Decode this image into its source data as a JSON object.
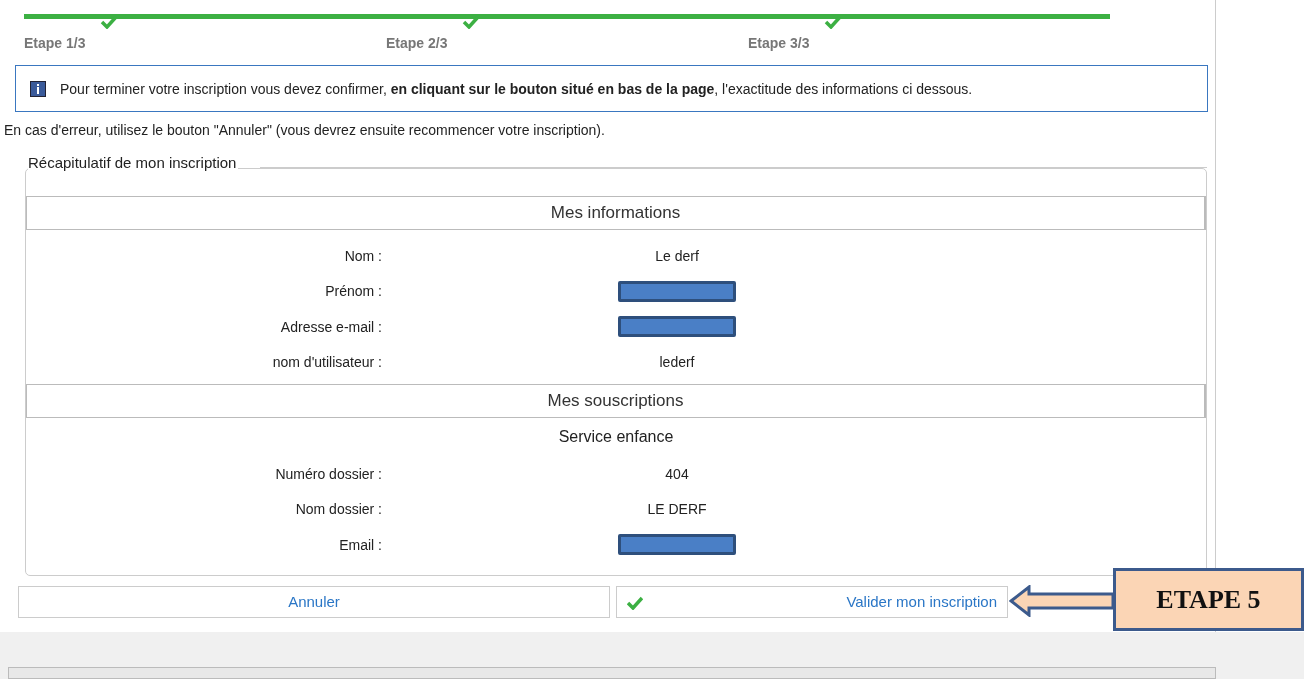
{
  "steps": [
    {
      "label": "Etape 1/3",
      "done": true
    },
    {
      "label": "Etape 2/3",
      "done": true
    },
    {
      "label": "Etape 3/3",
      "done": true
    }
  ],
  "info": "Pour terminer votre inscription vous devez confirmer, **en cliquant sur le bouton situé en bas de la page**, l'exactitude des informations ci dessous.",
  "error_note": "En cas d'erreur, utilisez le bouton \"Annuler\" (vous devrez ensuite recommencer votre inscription).",
  "summary": {
    "title": "Récapitulatif de mon inscription",
    "sections": [
      {
        "title": "Mes informations",
        "rows": [
          {
            "label": "Nom :",
            "value": "Le derf"
          },
          {
            "label": "Prénom :",
            "redacted": true
          },
          {
            "label": "Adresse e-mail :",
            "redacted": true
          },
          {
            "label": "nom d'utilisateur :",
            "value": "lederf"
          }
        ]
      },
      {
        "title": "Mes souscriptions",
        "subtitle": "Service enfance",
        "rows": [
          {
            "label": "Numéro dossier :",
            "value": "404"
          },
          {
            "label": "Nom dossier :",
            "value": "LE DERF"
          },
          {
            "label": "Email :",
            "redacted": true
          }
        ]
      }
    ]
  },
  "buttons": [
    {
      "label": "Annuler",
      "kind": "cancel"
    },
    {
      "label": "Valider mon inscription",
      "kind": "confirm"
    }
  ],
  "callout": {
    "label": "ETAPE 5"
  }
}
